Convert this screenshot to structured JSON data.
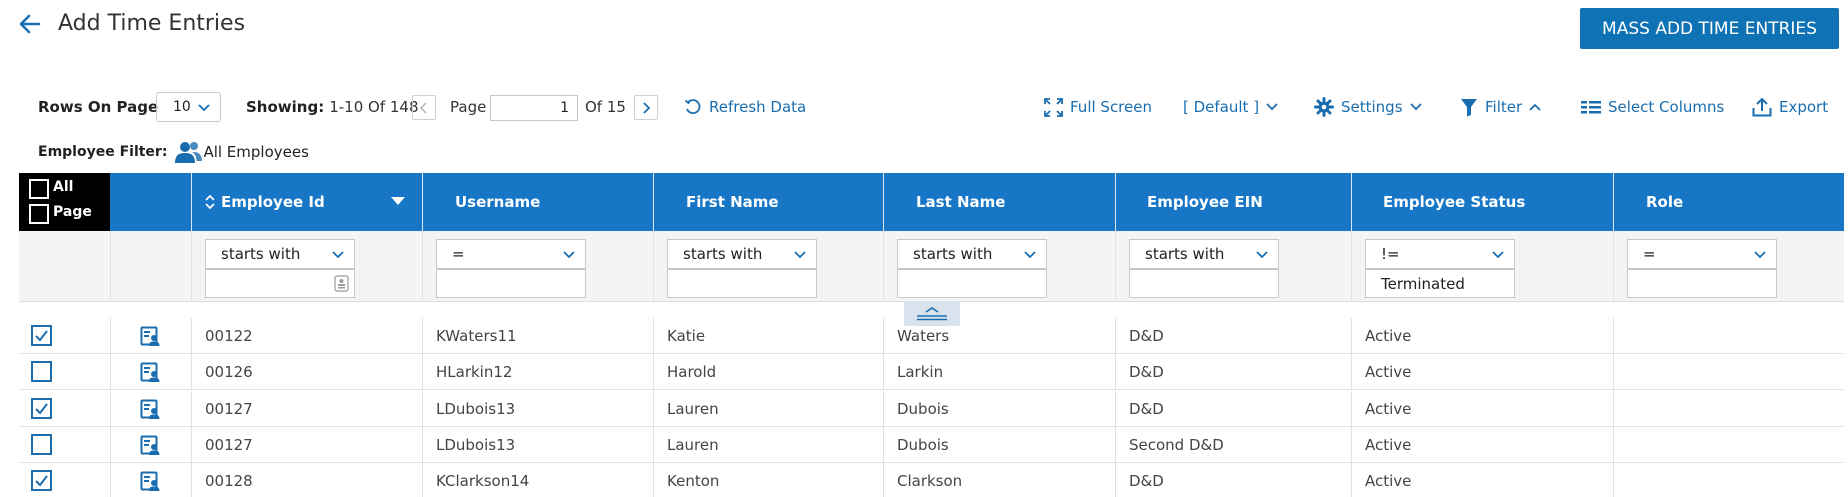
{
  "header": {
    "title": "Add Time Entries",
    "mass_add_label": "MASS ADD TIME ENTRIES"
  },
  "toolbar": {
    "rows_on_page_label": "Rows On Page",
    "rows_on_page_value": "10",
    "showing_label": "Showing:",
    "showing_value": "1-10 Of 148",
    "page_label": "Page",
    "page_value": "1",
    "of_pages": "Of 15",
    "refresh_label": "Refresh Data",
    "full_screen_label": "Full Screen",
    "view_label": "[ Default ]",
    "settings_label": "Settings",
    "filter_label": "Filter",
    "select_columns_label": "Select Columns",
    "export_label": "Export"
  },
  "employee_filter": {
    "label": "Employee Filter:",
    "value": "All Employees"
  },
  "grid": {
    "select_all_label": "All",
    "select_page_label": "Page",
    "columns": [
      "Employee Id",
      "Username",
      "First Name",
      "Last Name",
      "Employee EIN",
      "Employee Status",
      "Role"
    ],
    "filters": [
      {
        "operator": "starts with",
        "value": ""
      },
      {
        "operator": "=",
        "value": ""
      },
      {
        "operator": "starts with",
        "value": ""
      },
      {
        "operator": "starts with",
        "value": ""
      },
      {
        "operator": "starts with",
        "value": ""
      },
      {
        "operator": "!=",
        "value": "Terminated"
      },
      {
        "operator": "=",
        "value": ""
      }
    ],
    "rows": [
      {
        "checked": true,
        "employee_id": "00122",
        "username": "KWaters11",
        "first_name": "Katie",
        "last_name": "Waters",
        "ein": "D&D",
        "status": "Active",
        "role": ""
      },
      {
        "checked": false,
        "employee_id": "00126",
        "username": "HLarkin12",
        "first_name": "Harold",
        "last_name": "Larkin",
        "ein": "D&D",
        "status": "Active",
        "role": ""
      },
      {
        "checked": true,
        "employee_id": "00127",
        "username": "LDubois13",
        "first_name": "Lauren",
        "last_name": "Dubois",
        "ein": "D&D",
        "status": "Active",
        "role": ""
      },
      {
        "checked": false,
        "employee_id": "00127",
        "username": "LDubois13",
        "first_name": "Lauren",
        "last_name": "Dubois",
        "ein": "Second D&D",
        "status": "Active",
        "role": ""
      },
      {
        "checked": true,
        "employee_id": "00128",
        "username": "KClarkson14",
        "first_name": "Kenton",
        "last_name": "Clarkson",
        "ein": "D&D",
        "status": "Active",
        "role": ""
      }
    ]
  },
  "colors": {
    "accent": "#0f72b5",
    "header_bg": "#1777c6",
    "link": "#1a6eb0"
  },
  "icons": {
    "back": "arrow-left-icon",
    "refresh": "refresh-icon",
    "full_screen": "expand-icon",
    "settings": "gear-icon",
    "filter": "funnel-icon",
    "columns": "list-icon",
    "export": "upload-icon",
    "employees": "users-icon",
    "row_action": "employee-card-icon"
  }
}
